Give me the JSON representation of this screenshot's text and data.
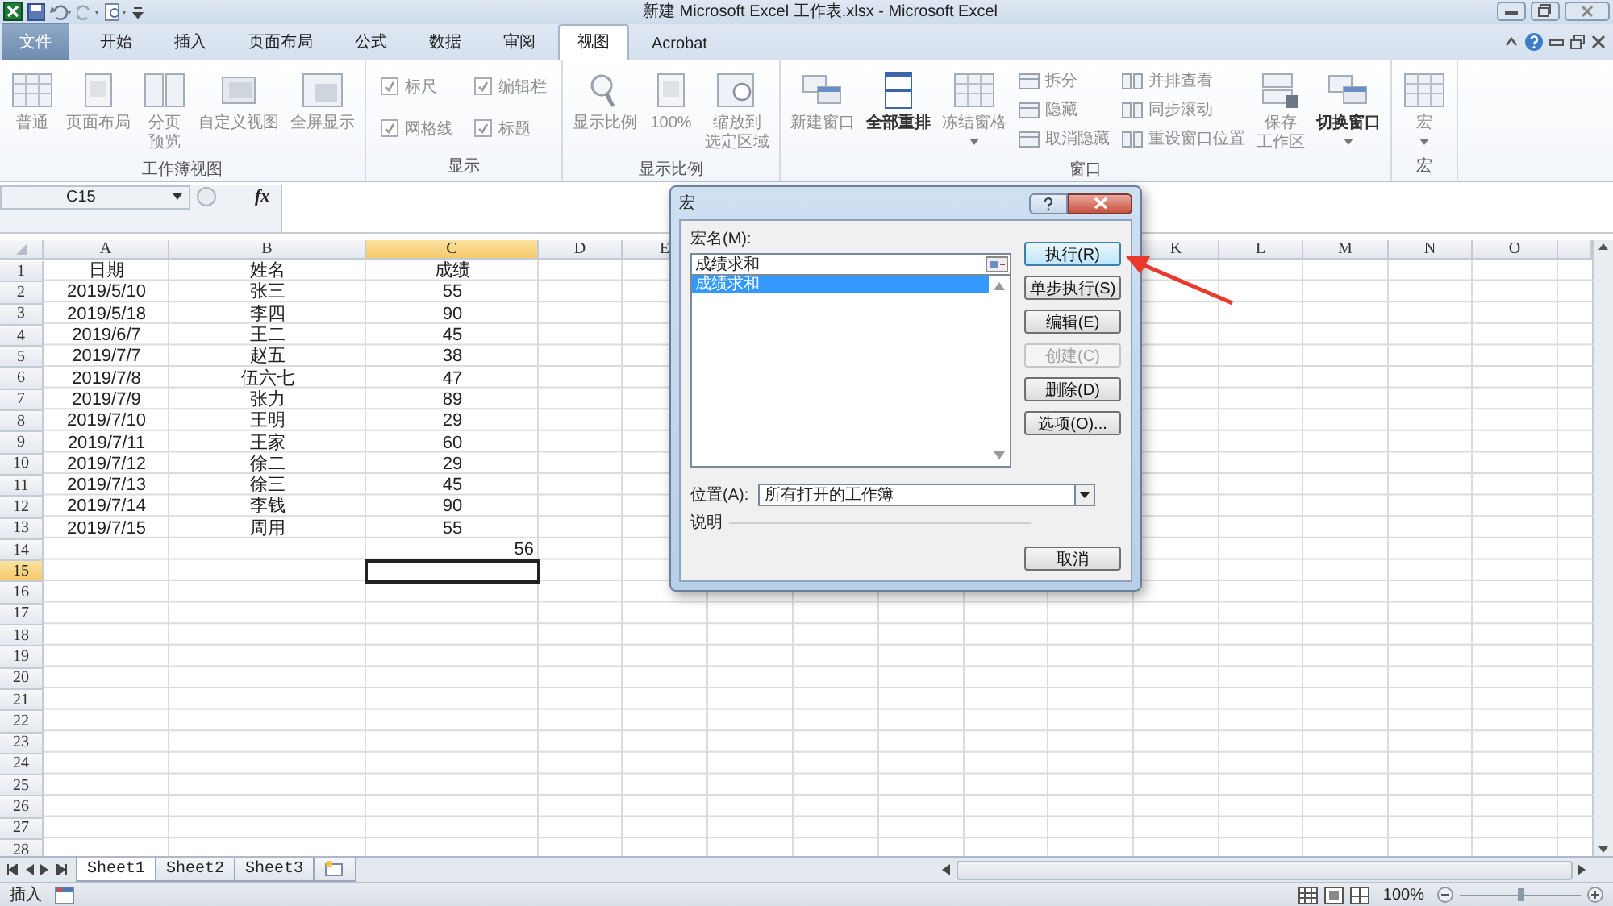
{
  "window": {
    "title": "新建 Microsoft Excel 工作表.xlsx - Microsoft Excel"
  },
  "tabs": [
    {
      "label": "文件",
      "kind": "file",
      "selected": false
    },
    {
      "label": "开始",
      "kind": "tab",
      "selected": false
    },
    {
      "label": "插入",
      "kind": "tab",
      "selected": false
    },
    {
      "label": "页面布局",
      "kind": "tab",
      "selected": false
    },
    {
      "label": "公式",
      "kind": "tab",
      "selected": false
    },
    {
      "label": "数据",
      "kind": "tab",
      "selected": false
    },
    {
      "label": "审阅",
      "kind": "tab",
      "selected": false
    },
    {
      "label": "视图",
      "kind": "tab",
      "selected": true
    },
    {
      "label": "Acrobat",
      "kind": "tab",
      "selected": false
    }
  ],
  "ribbon": {
    "groups": [
      {
        "label": "工作簿视图",
        "columns": [
          [
            {
              "kind": "large",
              "lines": [
                "普通"
              ],
              "disabled": true
            }
          ],
          [
            {
              "kind": "large",
              "lines": [
                "页面布局"
              ],
              "disabled": true
            }
          ],
          [
            {
              "kind": "large",
              "lines": [
                "分页",
                "预览"
              ],
              "disabled": true
            }
          ],
          [
            {
              "kind": "large",
              "lines": [
                "自定义视图"
              ],
              "disabled": true
            }
          ],
          [
            {
              "kind": "large",
              "lines": [
                "全屏显示"
              ],
              "disabled": true
            }
          ]
        ]
      },
      {
        "label": "显示",
        "columns": [
          [
            {
              "kind": "check",
              "label": "标尺",
              "checked": true,
              "disabled": true
            },
            {
              "kind": "check",
              "label": "网格线",
              "checked": true,
              "disabled": true
            }
          ],
          [
            {
              "kind": "check",
              "label": "编辑栏",
              "checked": true,
              "disabled": true
            },
            {
              "kind": "check",
              "label": "标题",
              "checked": true,
              "disabled": true
            }
          ]
        ]
      },
      {
        "label": "显示比例",
        "columns": [
          [
            {
              "kind": "large",
              "lines": [
                "显示比例"
              ],
              "disabled": true
            }
          ],
          [
            {
              "kind": "large",
              "lines": [
                "100%"
              ],
              "disabled": true
            }
          ],
          [
            {
              "kind": "large",
              "lines": [
                "缩放到",
                "选定区域"
              ],
              "disabled": true
            }
          ]
        ]
      },
      {
        "label": "窗口",
        "columns": [
          [
            {
              "kind": "large",
              "lines": [
                "新建窗口"
              ],
              "disabled": true
            }
          ],
          [
            {
              "kind": "large",
              "lines": [
                "全部重排"
              ],
              "disabled": false
            }
          ],
          [
            {
              "kind": "large",
              "lines": [
                "冻结窗格"
              ],
              "disabled": true,
              "menu": true
            }
          ],
          [
            {
              "kind": "small",
              "label": "拆分",
              "disabled": true
            },
            {
              "kind": "small",
              "label": "隐藏",
              "disabled": true
            },
            {
              "kind": "small",
              "label": "取消隐藏",
              "disabled": true
            }
          ],
          [
            {
              "kind": "small",
              "label": "并排查看",
              "disabled": true
            },
            {
              "kind": "small",
              "label": "同步滚动",
              "disabled": true
            },
            {
              "kind": "small",
              "label": "重设窗口位置",
              "disabled": true
            }
          ],
          [
            {
              "kind": "large",
              "lines": [
                "保存",
                "工作区"
              ],
              "disabled": true
            }
          ],
          [
            {
              "kind": "large",
              "lines": [
                "切换窗口"
              ],
              "disabled": false,
              "menu": true
            }
          ]
        ]
      },
      {
        "label": "宏",
        "columns": [
          [
            {
              "kind": "large",
              "lines": [
                "宏"
              ],
              "disabled": true,
              "menu": true
            }
          ]
        ]
      }
    ]
  },
  "formula_bar": {
    "name_box": "C15",
    "fx": "fx"
  },
  "grid": {
    "columns": [
      {
        "label": "A",
        "selected": false
      },
      {
        "label": "B",
        "selected": false
      },
      {
        "label": "C",
        "selected": true
      },
      {
        "label": "D",
        "selected": false
      },
      {
        "label": "E",
        "selected": false
      },
      {
        "label": "K",
        "selected": false
      },
      {
        "label": "L",
        "selected": false
      },
      {
        "label": "M",
        "selected": false
      },
      {
        "label": "N",
        "selected": false
      },
      {
        "label": "O",
        "selected": false
      }
    ],
    "rows": [
      {
        "number": "1",
        "selected": false,
        "column_a": {
          "text": "日期",
          "kind": "text"
        },
        "column_b": {
          "text": "姓名",
          "kind": "text"
        },
        "column_c": {
          "text": "成绩",
          "kind": "text"
        }
      },
      {
        "number": "2",
        "selected": false,
        "column_a": {
          "text": "2019/5/10",
          "kind": "text"
        },
        "column_b": {
          "text": "张三",
          "kind": "text"
        },
        "column_c": {
          "text": "55",
          "kind": "text"
        }
      },
      {
        "number": "3",
        "selected": false,
        "column_a": {
          "text": "2019/5/18",
          "kind": "text"
        },
        "column_b": {
          "text": "李四",
          "kind": "text"
        },
        "column_c": {
          "text": "90",
          "kind": "text"
        }
      },
      {
        "number": "4",
        "selected": false,
        "column_a": {
          "text": "2019/6/7",
          "kind": "text"
        },
        "column_b": {
          "text": "王二",
          "kind": "text"
        },
        "column_c": {
          "text": "45",
          "kind": "text"
        }
      },
      {
        "number": "5",
        "selected": false,
        "column_a": {
          "text": "2019/7/7",
          "kind": "text"
        },
        "column_b": {
          "text": "赵五",
          "kind": "text"
        },
        "column_c": {
          "text": "38",
          "kind": "text"
        }
      },
      {
        "number": "6",
        "selected": false,
        "column_a": {
          "text": "2019/7/8",
          "kind": "text"
        },
        "column_b": {
          "text": "伍六七",
          "kind": "text"
        },
        "column_c": {
          "text": "47",
          "kind": "text"
        }
      },
      {
        "number": "7",
        "selected": false,
        "column_a": {
          "text": "2019/7/9",
          "kind": "text"
        },
        "column_b": {
          "text": "张力",
          "kind": "text"
        },
        "column_c": {
          "text": "89",
          "kind": "text"
        }
      },
      {
        "number": "8",
        "selected": false,
        "column_a": {
          "text": "2019/7/10",
          "kind": "text"
        },
        "column_b": {
          "text": "王明",
          "kind": "text"
        },
        "column_c": {
          "text": "29",
          "kind": "text"
        }
      },
      {
        "number": "9",
        "selected": false,
        "column_a": {
          "text": "2019/7/11",
          "kind": "text"
        },
        "column_b": {
          "text": "王家",
          "kind": "text"
        },
        "column_c": {
          "text": "60",
          "kind": "text"
        }
      },
      {
        "number": "10",
        "selected": false,
        "column_a": {
          "text": "2019/7/12",
          "kind": "text"
        },
        "column_b": {
          "text": "徐二",
          "kind": "text"
        },
        "column_c": {
          "text": "29",
          "kind": "text"
        }
      },
      {
        "number": "11",
        "selected": false,
        "column_a": {
          "text": "2019/7/13",
          "kind": "text"
        },
        "column_b": {
          "text": "徐三",
          "kind": "text"
        },
        "column_c": {
          "text": "45",
          "kind": "text"
        }
      },
      {
        "number": "12",
        "selected": false,
        "column_a": {
          "text": "2019/7/14",
          "kind": "text"
        },
        "column_b": {
          "text": "李钱",
          "kind": "text"
        },
        "column_c": {
          "text": "90",
          "kind": "text"
        }
      },
      {
        "number": "13",
        "selected": false,
        "column_a": {
          "text": "2019/7/15",
          "kind": "text"
        },
        "column_b": {
          "text": "周用",
          "kind": "text"
        },
        "column_c": {
          "text": "55",
          "kind": "text"
        }
      },
      {
        "number": "14",
        "selected": false,
        "column_c": {
          "text": "56",
          "kind": "number"
        }
      },
      {
        "number": "15",
        "selected": true
      },
      {
        "number": "16",
        "selected": false
      },
      {
        "number": "17",
        "selected": false
      },
      {
        "number": "18",
        "selected": false
      },
      {
        "number": "19",
        "selected": false
      },
      {
        "number": "20",
        "selected": false
      },
      {
        "number": "21",
        "selected": false
      },
      {
        "number": "22",
        "selected": false
      },
      {
        "number": "23",
        "selected": false
      },
      {
        "number": "24",
        "selected": false
      },
      {
        "number": "25",
        "selected": false
      },
      {
        "number": "26",
        "selected": false
      },
      {
        "number": "27",
        "selected": false
      },
      {
        "number": "28",
        "selected": false
      }
    ]
  },
  "dialog": {
    "title": "宏",
    "name_label": "宏名(M):",
    "name_value": "成绩求和",
    "macros": [
      {
        "label": "成绩求和",
        "selected": true
      }
    ],
    "buttons": [
      {
        "label": "执行(R)",
        "disabled": false
      },
      {
        "label": "单步执行(S)",
        "disabled": false
      },
      {
        "label": "编辑(E)",
        "disabled": false
      },
      {
        "label": "创建(C)",
        "disabled": true
      },
      {
        "label": "删除(D)",
        "disabled": false
      },
      {
        "label": "选项(O)...",
        "disabled": false
      }
    ],
    "location_label": "位置(A):",
    "location_value": "所有打开的工作簿",
    "description_label": "说明",
    "cancel": "取消"
  },
  "sheet_tabs": [
    {
      "label": "Sheet1",
      "selected": true
    },
    {
      "label": "Sheet2",
      "selected": false
    },
    {
      "label": "Sheet3",
      "selected": false
    }
  ],
  "status_bar": {
    "mode": "插入",
    "zoom": "100%",
    "zoom_level": {
      "level": 0.5
    }
  }
}
